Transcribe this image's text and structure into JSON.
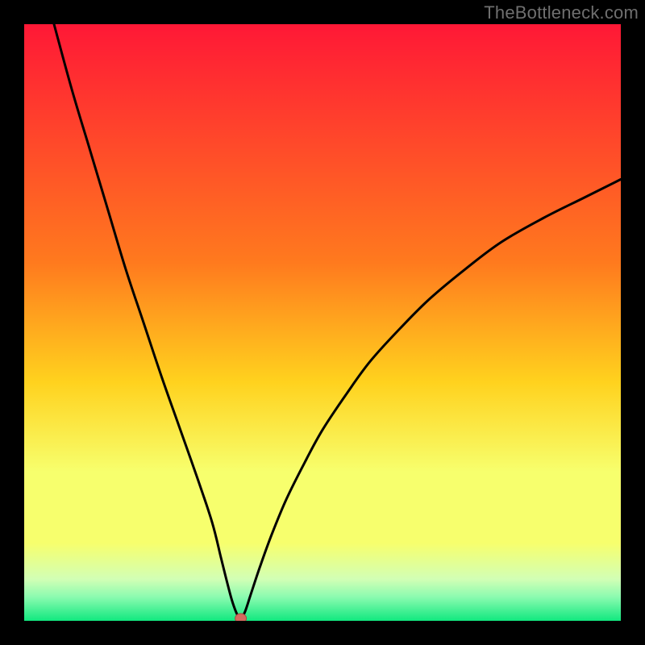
{
  "watermark": "TheBottleneck.com",
  "colors": {
    "top": "#ff1836",
    "mid_upper": "#ff7a1e",
    "mid": "#ffd21e",
    "mid_lower": "#f7ff6d",
    "lower1": "#d2ffb5",
    "lower2": "#8bfbb0",
    "bottom": "#11e87f",
    "curve": "#000000",
    "marker_fill": "#d46a5e",
    "marker_stroke": "#a84a40"
  },
  "chart_data": {
    "type": "line",
    "title": "",
    "xlabel": "",
    "ylabel": "",
    "xlim": [
      0,
      100
    ],
    "ylim": [
      0,
      100
    ],
    "x": [
      5,
      8,
      11,
      14,
      17,
      20,
      23,
      26,
      29,
      31.5,
      33,
      34,
      34.8,
      35.5,
      36,
      36.3,
      37,
      38,
      39.5,
      41.5,
      44,
      47,
      50,
      54,
      58,
      63,
      68,
      74,
      80,
      87,
      94,
      100
    ],
    "values": [
      100,
      89,
      79,
      69,
      59,
      50,
      41,
      32.5,
      24,
      16.5,
      10.5,
      6.5,
      3.5,
      1.5,
      0.6,
      0.4,
      1.5,
      4.5,
      9,
      14.5,
      20.5,
      26.5,
      32,
      38,
      43.5,
      49,
      54,
      59,
      63.5,
      67.5,
      71,
      74
    ],
    "marker": {
      "x": 36.3,
      "y": 0.4
    },
    "gradient_stops_pct": [
      0,
      40,
      60,
      75,
      87,
      93,
      96,
      100
    ]
  }
}
